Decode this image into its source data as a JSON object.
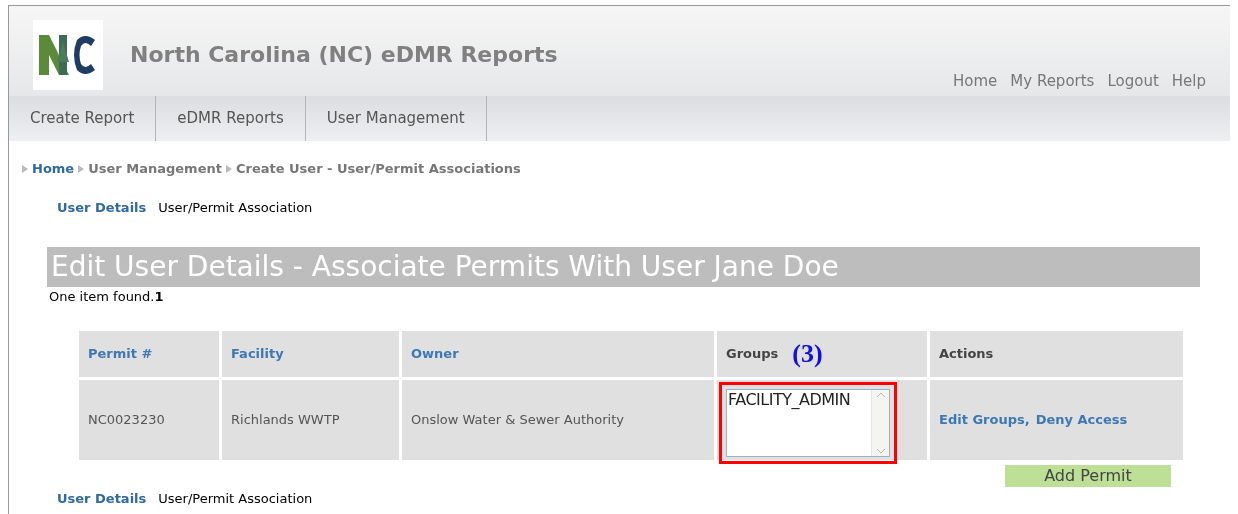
{
  "header": {
    "title": "North Carolina (NC) eDMR Reports",
    "links": [
      "Home",
      "My Reports",
      "Logout",
      "Help"
    ]
  },
  "nav": [
    "Create Report",
    "eDMR Reports",
    "User Management"
  ],
  "breadcrumb": [
    "Home",
    "User Management",
    "Create User - User/Permit Associations"
  ],
  "subnav": [
    {
      "label": "User Details",
      "kind": "link"
    },
    {
      "label": "User/Permit Association",
      "kind": "text"
    }
  ],
  "heading": "Edit User Details - Associate Permits With User Jane Doe",
  "result": "One item found.**1**",
  "table": {
    "columns": [
      {
        "label": "Permit #",
        "kind": "link"
      },
      {
        "label": "Facility",
        "kind": "link"
      },
      {
        "label": "Owner",
        "kind": "link"
      },
      {
        "label": "Groups",
        "kind": "text",
        "annotation": "(3)"
      },
      {
        "label": "Actions",
        "kind": "text"
      }
    ],
    "rows": [
      {
        "permit": "NC0023230",
        "facility": "Richlands WWTP",
        "owner": "Onslow Water & Sewer Authority",
        "groups": [
          "FACILITY_ADMIN"
        ],
        "groups_highlighted": true,
        "actions": [
          "Edit Groups,",
          "Deny Access"
        ]
      }
    ]
  },
  "add_button": "Add Permit",
  "footer_subnav": [
    {
      "label": "User Details",
      "kind": "link"
    },
    {
      "label": "User/Permit Association",
      "kind": "text"
    }
  ]
}
